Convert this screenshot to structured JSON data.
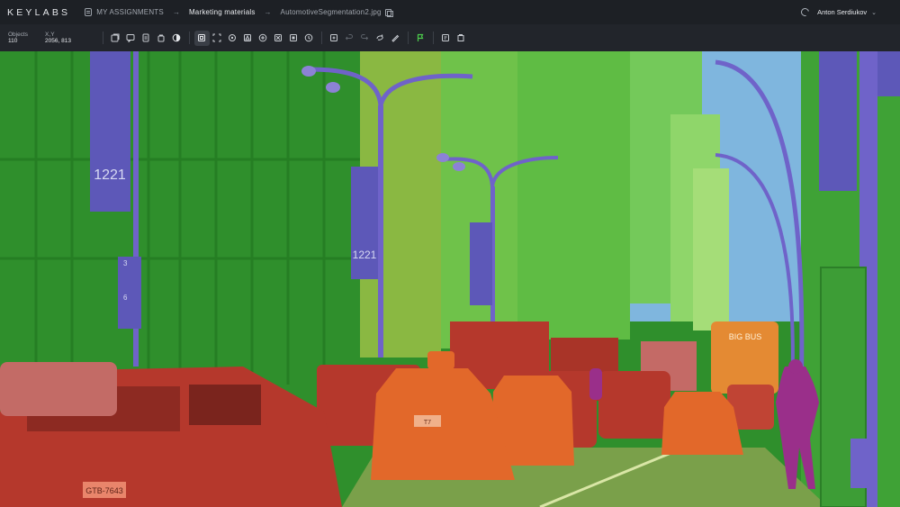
{
  "header": {
    "logo": "KEYLABS",
    "breadcrumb": [
      "MY ASSIGNMENTS",
      "Marketing materials",
      "AutomotiveSegmentation2.jpg"
    ],
    "user_name": "Anton Serdiukov"
  },
  "stats": {
    "objects_label": "Objects",
    "objects_value": "110",
    "xy_label": "X,Y",
    "xy_value": "2056, 813"
  },
  "scene_text": {
    "banner_left_number": "1221",
    "banner_mid_number": "1221",
    "street_sign": "3",
    "street_sign_2": "6",
    "bus_sign": "BIG BUS",
    "taxi_plate_left": "GTB-7643",
    "taxi_plate_mid": "T7"
  },
  "toolbar_icons": [
    "select-icon",
    "comment-icon",
    "document-icon",
    "bag-icon",
    "contrast-icon",
    "box-tool-icon",
    "move-icon",
    "target-icon",
    "polygon-icon",
    "grid-icon",
    "keypoint-icon",
    "mask-icon",
    "cuboid-icon",
    "time-icon",
    "zoom-fit-icon",
    "undo-icon",
    "redo-icon",
    "magic-icon",
    "brush-icon",
    "flag-icon",
    "export-icon",
    "save-icon"
  ],
  "colors": {
    "building": "#2f8f2c",
    "building_light": "#6fcf48",
    "sky": "#7fb6de",
    "vehicle": "#b5382c",
    "taxi": "#e2682a",
    "pole": "#6f63c9",
    "banner": "#5d58b8",
    "road": "#7aa04a",
    "person": "#9a2f8a"
  }
}
